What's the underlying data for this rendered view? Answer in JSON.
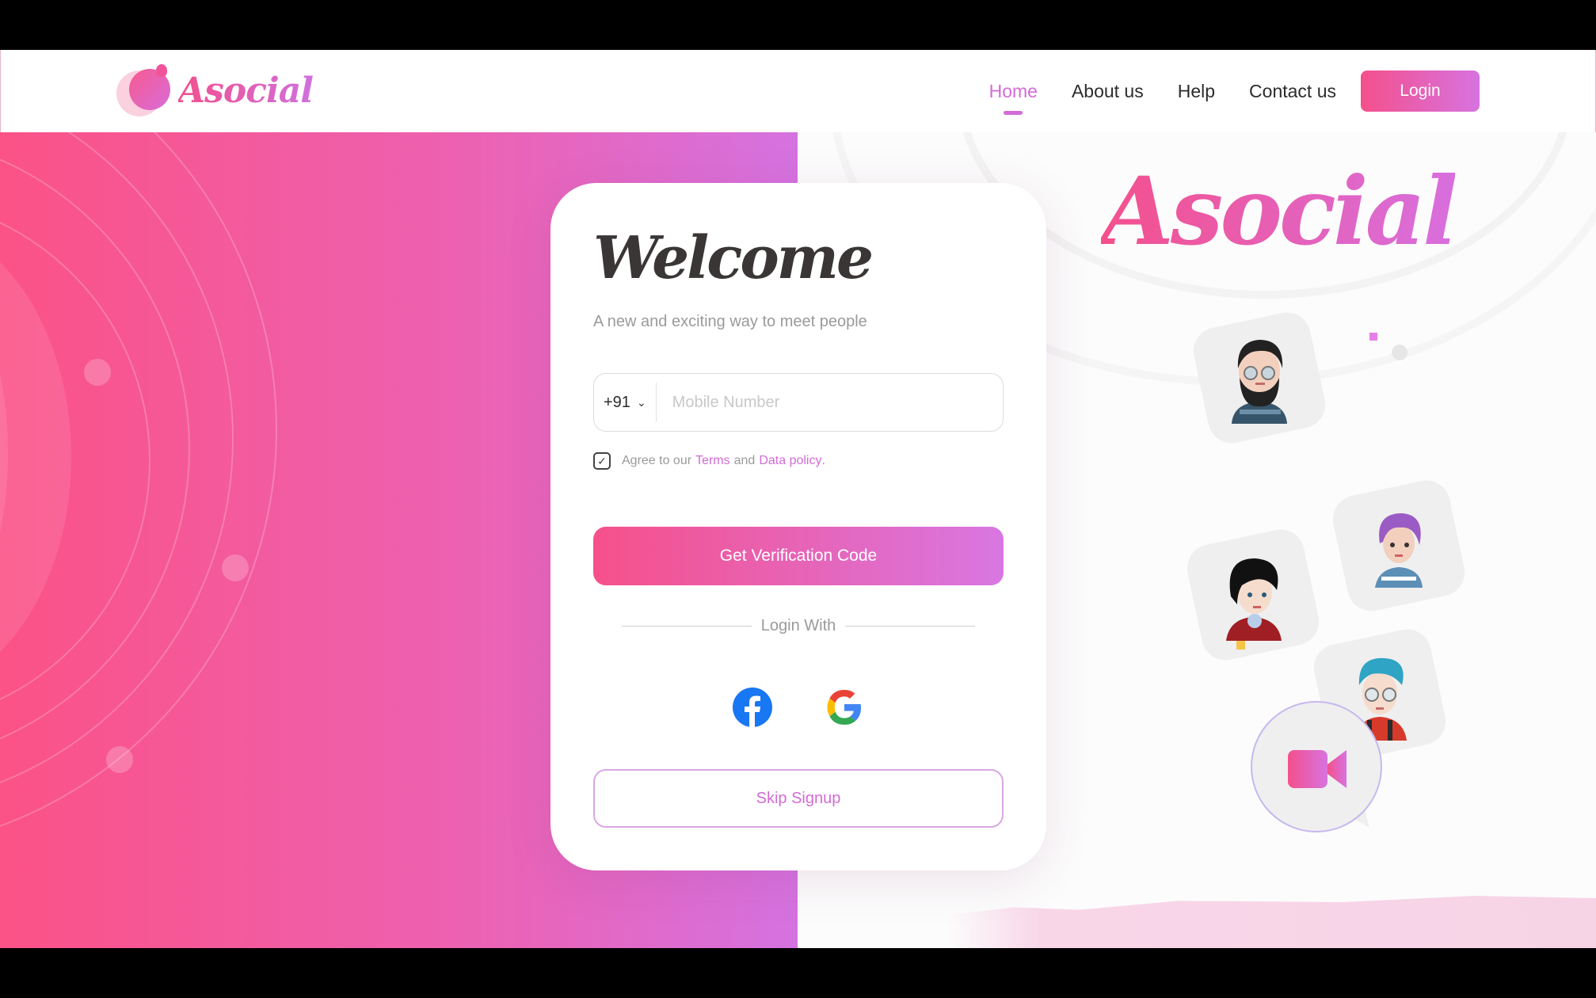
{
  "header": {
    "brand": "Asocial",
    "nav": [
      {
        "label": "Home",
        "active": true
      },
      {
        "label": "About us",
        "active": false
      },
      {
        "label": "Help",
        "active": false
      },
      {
        "label": "Contact us",
        "active": false
      }
    ],
    "login_label": "Login"
  },
  "card": {
    "title": "Welcome",
    "subtitle": "A new and exciting way to meet people",
    "country_code": "+91",
    "phone_placeholder": "Mobile Number",
    "phone_value": "",
    "agree_prefix": "Agree to our",
    "terms_link": "Terms",
    "agree_and": "and",
    "policy_link": "Data policy",
    "agree_suffix": ".",
    "agree_checked": true,
    "verify_label": "Get Verification Code",
    "login_with": "Login With",
    "socials": [
      "facebook-icon",
      "google-icon"
    ],
    "skip_label": "Skip Signup"
  },
  "hero": {
    "brand_big": "Asocial"
  },
  "colors": {
    "accent": "#d36bd6",
    "pink": "#f4508c",
    "gradient_end": "#d773e0",
    "text_dark": "#2c2c2c"
  }
}
